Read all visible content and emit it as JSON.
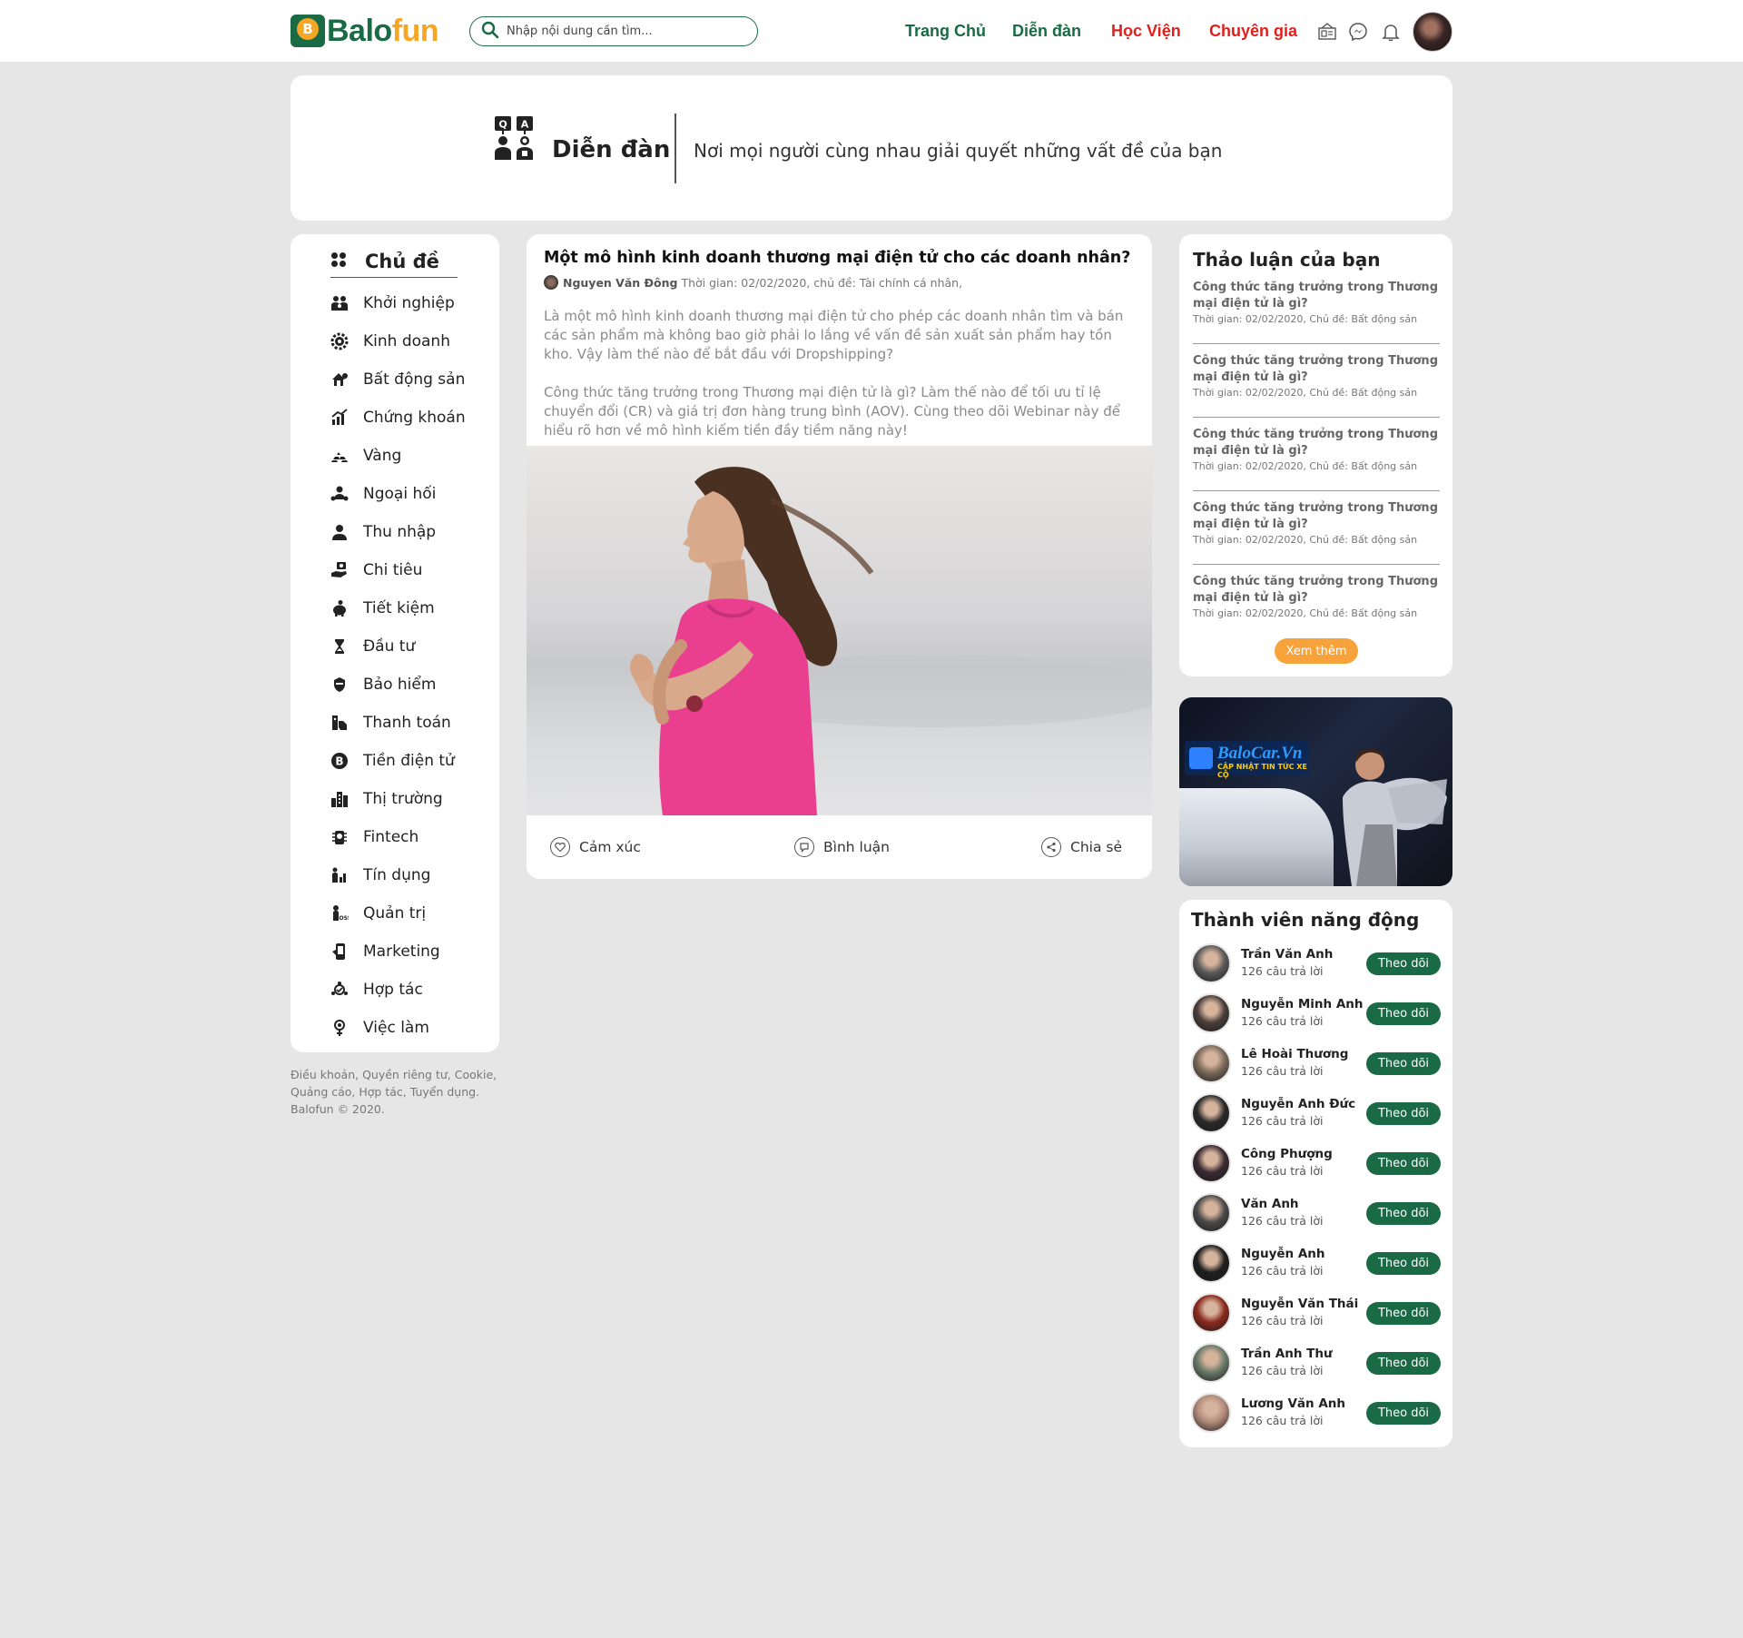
{
  "header": {
    "logo_b": "B",
    "logo_text_1": "Balo",
    "logo_text_2": "fun",
    "search_placeholder": "Nhập nội dung cần tìm...",
    "nav": [
      {
        "label": "Trang Chủ",
        "color": "#1a6b45"
      },
      {
        "label": "Diễn đàn",
        "color": "#1a6b45"
      },
      {
        "label": "Học Viện",
        "color": "#e0201b"
      },
      {
        "label": "Chuyên gia",
        "color": "#e0201b"
      }
    ],
    "icons": [
      "news-icon",
      "messenger-icon",
      "bell-icon"
    ]
  },
  "banner": {
    "title": "Diễn đàn",
    "subtitle": "Nơi mọi người cùng nhau giải quyết những vất đề của bạn",
    "icon": "qa-forum-icon"
  },
  "sidebar": {
    "heading": "Chủ đề",
    "items": [
      {
        "label": "Khởi nghiệp",
        "icon": "startup-icon"
      },
      {
        "label": "Kinh doanh",
        "icon": "business-gear-icon"
      },
      {
        "label": "Bất động sản",
        "icon": "real-estate-icon"
      },
      {
        "label": "Chứng khoán",
        "icon": "stock-chart-icon"
      },
      {
        "label": "Vàng",
        "icon": "gold-bars-icon"
      },
      {
        "label": "Ngoại hối",
        "icon": "forex-icon"
      },
      {
        "label": "Thu nhập",
        "icon": "income-user-icon"
      },
      {
        "label": "Chi tiêu",
        "icon": "spending-hand-icon"
      },
      {
        "label": "Tiết kiệm",
        "icon": "piggy-bank-icon"
      },
      {
        "label": "Đầu tư",
        "icon": "investment-hourglass-icon"
      },
      {
        "label": "Bảo hiểm",
        "icon": "insurance-shield-icon"
      },
      {
        "label": "Thanh toán",
        "icon": "payment-icon"
      },
      {
        "label": "Tiền điện tử",
        "icon": "bitcoin-icon"
      },
      {
        "label": "Thị trường",
        "icon": "market-buildings-icon"
      },
      {
        "label": "Fintech",
        "icon": "fintech-icon"
      },
      {
        "label": "Tín dụng",
        "icon": "credit-icon"
      },
      {
        "label": "Quản trị",
        "icon": "boss-icon"
      },
      {
        "label": "Marketing",
        "icon": "marketing-phone-icon"
      },
      {
        "label": "Hợp tác",
        "icon": "cooperation-icon"
      },
      {
        "label": "Việc làm",
        "icon": "job-icon"
      }
    ]
  },
  "footer": {
    "text": "Điều khoản, Quyền riêng tư, Cookie, Quảng cáo, Hợp tác, Tuyển dụng. Balofun © 2020."
  },
  "post": {
    "title": "Một mô hình kinh doanh thương mại điện tử cho các doanh nhân?",
    "author": "Nguyen Văn Đông",
    "meta": "Thời gian: 02/02/2020, chủ đề: Tài chính cá nhân,",
    "paragraph_1": "Là một mô hình kinh doanh thương mại điện tử cho phép các doanh nhân tìm và bán các sản phẩm mà không bao giờ phải lo lắng về vấn đề sản xuất sản phẩm hay tồn kho. Vậy làm thế nào để bắt  đầu với Dropshipping?",
    "paragraph_2": "Công thức tăng trưởng trong Thương mại điện tử là gì? Làm thế nào để tối ưu tỉ lệ chuyển đổi (CR) và giá trị đơn hàng trung bình (AOV). Cùng theo dõi Webinar này để hiểu rõ hơn về mô hình kiếm tiền đầy tiềm năng này!",
    "image": "woman-running-photo",
    "actions": {
      "react": "Cảm xúc",
      "comment": "Bình luận",
      "share": "Chia sẻ"
    }
  },
  "discussions": {
    "heading": "Thảo luận của bạn",
    "items": [
      {
        "title": "Công thức tăng trưởng trong Thương mại điện tử là gì?",
        "meta": "Thời gian: 02/02/2020, Chủ đề: Bất động sản"
      },
      {
        "title": "Công thức tăng trưởng trong Thương mại điện tử là gì?",
        "meta": "Thời gian: 02/02/2020, Chủ đề: Bất động sản"
      },
      {
        "title": "Công thức tăng trưởng trong Thương mại điện tử là gì?",
        "meta": "Thời gian: 02/02/2020, Chủ đề: Bất động sản"
      },
      {
        "title": "Công thức tăng trưởng trong Thương mại điện tử là gì?",
        "meta": "Thời gian: 02/02/2020, Chủ đề: Bất động sản"
      },
      {
        "title": "Công thức tăng trưởng trong Thương mại điện tử là gì?",
        "meta": "Thời gian: 02/02/2020, Chủ đề: Bất động sản"
      }
    ],
    "more_label": "Xem thêm"
  },
  "ad": {
    "brand": "BaloCar.Vn",
    "tagline": "CẬP NHẬT TIN TỨC XE CỘ"
  },
  "members": {
    "heading": "Thành viên năng động",
    "follow_label": "Theo dõi",
    "items": [
      {
        "name": "Trần Văn Anh",
        "count": "126 câu trả lời",
        "avatar_color": "#5a5a5a"
      },
      {
        "name": "Nguyễn Minh Anh",
        "count": "126 câu trả lời",
        "avatar_color": "#4a3e3a"
      },
      {
        "name": "Lê Hoài Thương",
        "count": "126 câu trả lời",
        "avatar_color": "#7a6a5a"
      },
      {
        "name": "Nguyễn Anh Đức",
        "count": "126 câu trả lời",
        "avatar_color": "#2a2a2a"
      },
      {
        "name": "Công Phượng",
        "count": "126 câu trả lời",
        "avatar_color": "#3a2a32"
      },
      {
        "name": "Văn Anh",
        "count": "126 câu trả lời",
        "avatar_color": "#4a4a4a"
      },
      {
        "name": "Nguyễn Anh",
        "count": "126 câu trả lời",
        "avatar_color": "#1e1e1e"
      },
      {
        "name": "Nguyễn Văn Thái",
        "count": "126 câu trả lời",
        "avatar_color": "#8a2a1e"
      },
      {
        "name": "Trần Anh Thư",
        "count": "126 câu trả lời",
        "avatar_color": "#6a7a6a"
      },
      {
        "name": "Lương Văn Anh",
        "count": "126 câu trả lời",
        "avatar_color": "#b08a7a"
      }
    ]
  }
}
